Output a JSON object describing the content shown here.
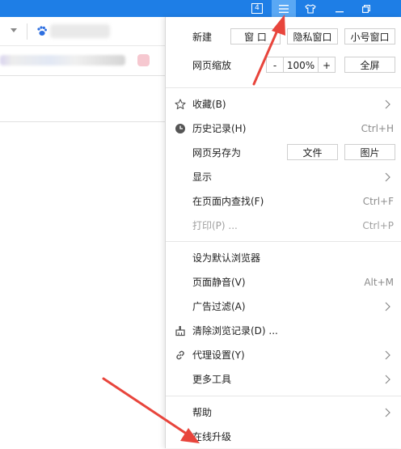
{
  "titlebar": {
    "tab_count": "4",
    "menu_icon": "hamburger-icon",
    "skin_icon": "tshirt-icon",
    "minimize_icon": "minimize-icon",
    "restore_icon": "restore-icon",
    "accent": "#1e7ee6",
    "active_bg": "#5aa8f4"
  },
  "menu": {
    "new": {
      "label": "新建",
      "buttons": [
        "窗 口",
        "隐私窗口",
        "小号窗口"
      ]
    },
    "zoom": {
      "label": "网页缩放",
      "minus": "-",
      "value": "100%",
      "plus": "+",
      "fullscreen": "全屏"
    },
    "favorites": {
      "label": "收藏(B)",
      "icon": "star-icon"
    },
    "history": {
      "label": "历史记录(H)",
      "shortcut": "Ctrl+H",
      "icon": "clock-icon"
    },
    "save_as": {
      "label": "网页另存为",
      "buttons": [
        "文件",
        "图片"
      ]
    },
    "display": {
      "label": "显示"
    },
    "find": {
      "label": "在页面内查找(F)",
      "shortcut": "Ctrl+F"
    },
    "print": {
      "label": "打印(P) ...",
      "shortcut": "Ctrl+P"
    },
    "default_browser": {
      "label": "设为默认浏览器"
    },
    "mute": {
      "label": "页面静音(V)",
      "shortcut": "Alt+M"
    },
    "ad_filter": {
      "label": "广告过滤(A)"
    },
    "clear_history": {
      "label": "清除浏览记录(D) ...",
      "icon": "broom-icon"
    },
    "proxy": {
      "label": "代理设置(Y)",
      "icon": "link-icon"
    },
    "more_tools": {
      "label": "更多工具"
    },
    "help": {
      "label": "帮助"
    },
    "upgrade": {
      "label": "在线升级"
    }
  },
  "annotation_color": "#e8453c"
}
